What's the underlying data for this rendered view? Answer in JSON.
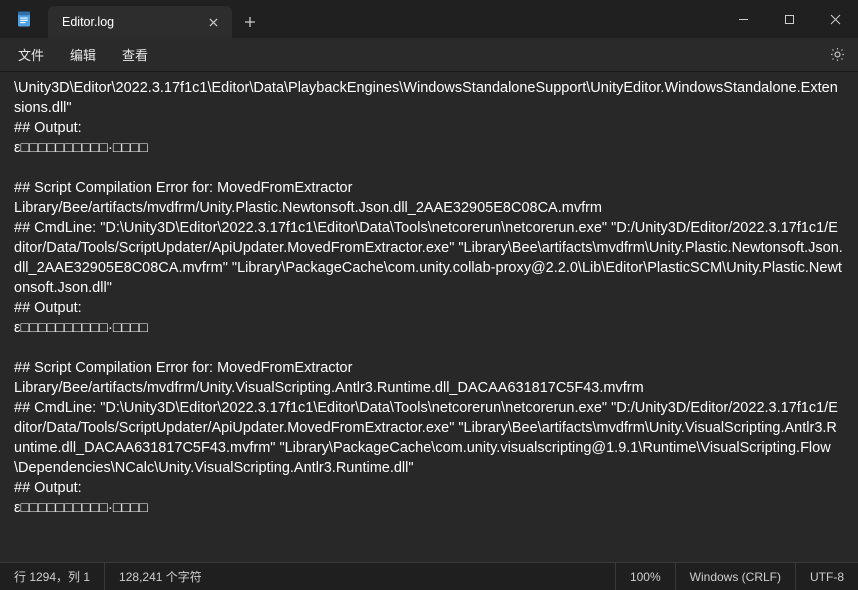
{
  "titlebar": {
    "tab_title": "Editor.log"
  },
  "menu": {
    "file": "文件",
    "edit": "编辑",
    "view": "查看"
  },
  "content": {
    "text": "\\Unity3D\\Editor\\2022.3.17f1c1\\Editor\\Data\\PlaybackEngines\\WindowsStandaloneSupport\\UnityEditor.WindowsStandalone.Extensions.dll\"\n## Output:\nε□□□□□□□□□□·□□□□\n\n## Script Compilation Error for: MovedFromExtractor\nLibrary/Bee/artifacts/mvdfrm/Unity.Plastic.Newtonsoft.Json.dll_2AAE32905E8C08CA.mvfrm\n## CmdLine: \"D:\\Unity3D\\Editor\\2022.3.17f1c1\\Editor\\Data\\Tools\\netcorerun\\netcorerun.exe\" \"D:/Unity3D/Editor/2022.3.17f1c1/Editor/Data/Tools/ScriptUpdater/ApiUpdater.MovedFromExtractor.exe\" \"Library\\Bee\\artifacts\\mvdfrm\\Unity.Plastic.Newtonsoft.Json.dll_2AAE32905E8C08CA.mvfrm\" \"Library\\PackageCache\\com.unity.collab-proxy@2.2.0\\Lib\\Editor\\PlasticSCM\\Unity.Plastic.Newtonsoft.Json.dll\"\n## Output:\nε□□□□□□□□□□·□□□□\n\n## Script Compilation Error for: MovedFromExtractor\nLibrary/Bee/artifacts/mvdfrm/Unity.VisualScripting.Antlr3.Runtime.dll_DACAA631817C5F43.mvfrm\n## CmdLine: \"D:\\Unity3D\\Editor\\2022.3.17f1c1\\Editor\\Data\\Tools\\netcorerun\\netcorerun.exe\" \"D:/Unity3D/Editor/2022.3.17f1c1/Editor/Data/Tools/ScriptUpdater/ApiUpdater.MovedFromExtractor.exe\" \"Library\\Bee\\artifacts\\mvdfrm\\Unity.VisualScripting.Antlr3.Runtime.dll_DACAA631817C5F43.mvfrm\" \"Library\\PackageCache\\com.unity.visualscripting@1.9.1\\Runtime\\VisualScripting.Flow\\Dependencies\\NCalc\\Unity.VisualScripting.Antlr3.Runtime.dll\"\n## Output:\nε□□□□□□□□□□·□□□□\n"
  },
  "status": {
    "position": "行 1294，列 1",
    "chars": "128,241 个字符",
    "zoom": "100%",
    "eol": "Windows (CRLF)",
    "encoding": "UTF-8"
  }
}
